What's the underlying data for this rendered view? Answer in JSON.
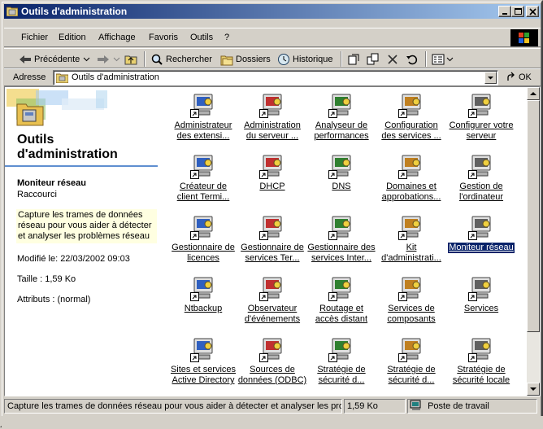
{
  "window": {
    "title": "Outils d'administration",
    "title_icon": "folder-icon",
    "controls": [
      "minimize-icon",
      "maximize-icon",
      "close-icon"
    ]
  },
  "menubar": {
    "items": [
      "Fichier",
      "Edition",
      "Affichage",
      "Favoris",
      "Outils",
      "?"
    ]
  },
  "toolbar": {
    "back_label": "Précédente",
    "search_label": "Rechercher",
    "folders_label": "Dossiers",
    "history_label": "Historique"
  },
  "address": {
    "label": "Adresse",
    "value": "Outils d'administration",
    "go_label": "OK"
  },
  "left_panel": {
    "title": "Outils d'administration",
    "selected_name": "Moniteur réseau",
    "selected_type": "Raccourci",
    "description": "Capture les trames de données réseau pour vous aider à détecter et analyser les problèmes réseau",
    "modified": "Modifié le: 22/03/2002 09:03",
    "size": "Taille : 1,59 Ko",
    "attributes": "Attributs : (normal)"
  },
  "icons": [
    {
      "line1": "Administrateur",
      "line2": "des extensi...",
      "icon": "ext-admin-icon"
    },
    {
      "line1": "Administration",
      "line2": "du serveur ...",
      "icon": "server-admin-icon"
    },
    {
      "line1": "Analyseur de",
      "line2": "performances",
      "icon": "perf-icon"
    },
    {
      "line1": "Configuration",
      "line2": "des services ...",
      "icon": "config-icon"
    },
    {
      "line1": "Configurer votre",
      "line2": "serveur",
      "icon": "configure-server-icon"
    },
    {
      "line1": "Créateur de",
      "line2": "client Termi...",
      "icon": "terminal-client-icon"
    },
    {
      "line1": "DHCP",
      "line2": "",
      "icon": "dhcp-icon"
    },
    {
      "line1": "DNS",
      "line2": "",
      "icon": "dns-icon"
    },
    {
      "line1": "Domaines et",
      "line2": "approbations...",
      "icon": "domains-icon"
    },
    {
      "line1": "Gestion de",
      "line2": "l'ordinateur",
      "icon": "computer-mgmt-icon"
    },
    {
      "line1": "Gestionnaire de",
      "line2": "licences",
      "icon": "license-icon"
    },
    {
      "line1": "Gestionnaire de",
      "line2": "services Ter...",
      "icon": "terminal-services-icon"
    },
    {
      "line1": "Gestionnaire des",
      "line2": "services Inter...",
      "icon": "internet-services-icon"
    },
    {
      "line1": "Kit",
      "line2": "d'administrati...",
      "icon": "admin-kit-icon"
    },
    {
      "line1": "Moniteur réseau",
      "line2": "",
      "icon": "network-monitor-icon"
    },
    {
      "line1": "Ntbackup",
      "line2": "",
      "icon": "backup-icon"
    },
    {
      "line1": "Observateur",
      "line2": "d'événements",
      "icon": "event-viewer-icon"
    },
    {
      "line1": "Routage et",
      "line2": "accès distant",
      "icon": "routing-icon"
    },
    {
      "line1": "Services de",
      "line2": "composants",
      "icon": "component-services-icon"
    },
    {
      "line1": "Services",
      "line2": "",
      "icon": "services-icon"
    },
    {
      "line1": "Sites et services",
      "line2": "Active Directory",
      "icon": "ad-sites-icon"
    },
    {
      "line1": "Sources de",
      "line2": "données (ODBC)",
      "icon": "odbc-icon"
    },
    {
      "line1": "Stratégie de",
      "line2": "sécurité d...",
      "icon": "security-policy-icon"
    },
    {
      "line1": "Stratégie de",
      "line2": "sécurité d...",
      "icon": "security-policy-icon"
    },
    {
      "line1": "Stratégie de",
      "line2": "sécurité locale",
      "icon": "local-security-icon"
    }
  ],
  "statusbar": {
    "message": "Capture les trames de données réseau pour vous aider à détecter et analyser les prol",
    "size": "1,59 Ko",
    "zone": "Poste de travail"
  },
  "colors": {
    "title_start": "#0a246a",
    "title_end": "#a6caf0",
    "face": "#d4d0c8",
    "selection": "#0a246a",
    "tooltip_bg": "#ffffe1"
  }
}
